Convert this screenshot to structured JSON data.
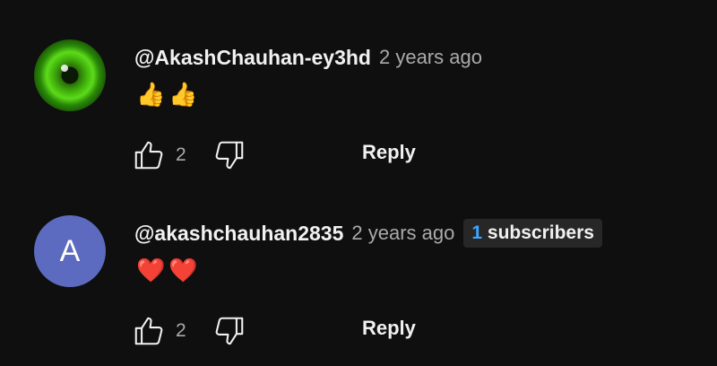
{
  "comments": [
    {
      "author": "@AkashChauhan-ey3hd",
      "time": "2 years ago",
      "text": "👍👍",
      "likes": "2",
      "reply_label": "Reply",
      "avatar": "green-eye-avatar"
    },
    {
      "author": "@akashchauhan2835",
      "time": "2 years ago",
      "badge_count": "1",
      "badge_label": "subscribers",
      "text": "❤️❤️",
      "likes": "2",
      "reply_label": "Reply",
      "avatar_letter": "A",
      "avatar_color": "#5c6bc0"
    }
  ],
  "colors": {
    "background": "#0f0f0f",
    "primary_text": "#f1f1f1",
    "secondary_text": "#aaaaaa",
    "badge_bg": "#272727",
    "badge_accent": "#3ea6ff"
  }
}
